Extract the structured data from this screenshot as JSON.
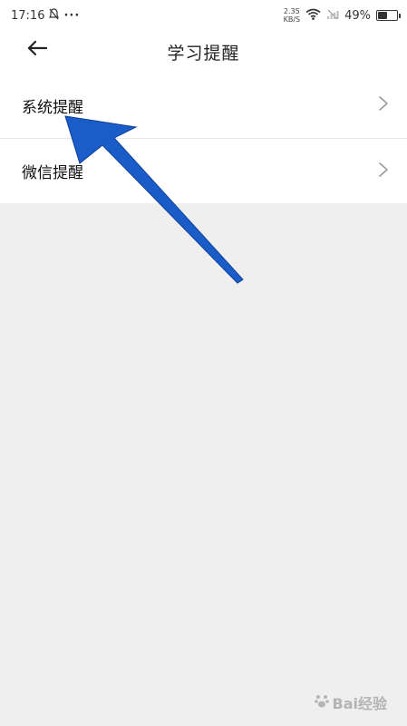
{
  "status_bar": {
    "time": "17:16",
    "net_speed_value": "2.35",
    "net_speed_unit": "KB/S",
    "battery_percent": "49%",
    "battery_level": 0.49
  },
  "header": {
    "title": "学习提醒"
  },
  "list": {
    "items": [
      {
        "label": "系统提醒"
      },
      {
        "label": "微信提醒"
      }
    ]
  },
  "watermark": {
    "text": "Bai经验"
  },
  "colors": {
    "annotation_arrow": "#1a5cc8",
    "background": "#efefef",
    "surface": "#ffffff"
  }
}
